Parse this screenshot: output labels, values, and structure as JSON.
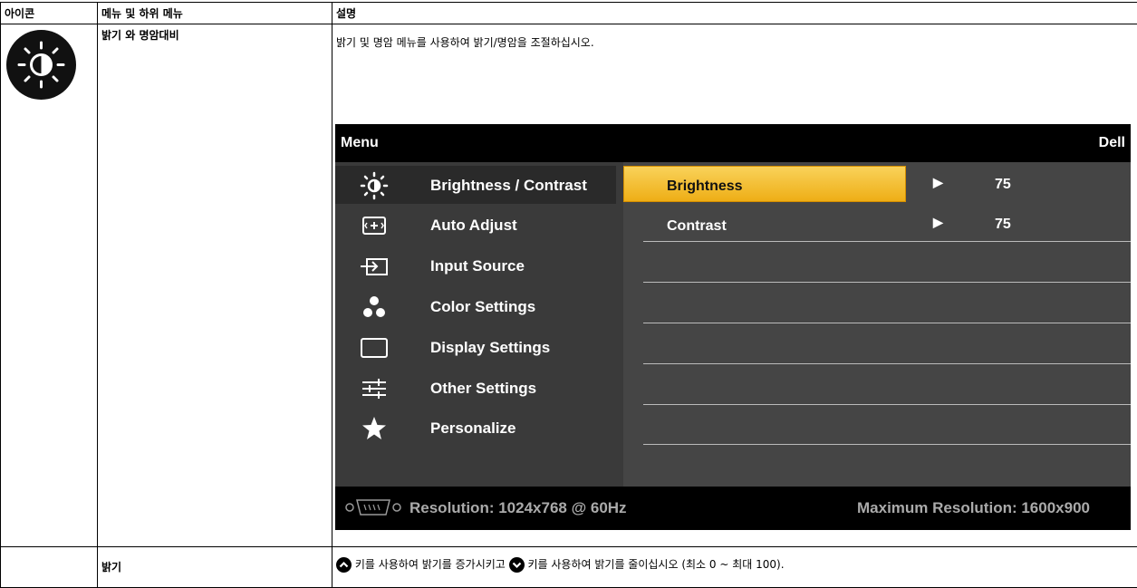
{
  "table": {
    "headers": {
      "icon": "아이콘",
      "menu": "메뉴 및 하위 메뉴",
      "desc": "설명"
    },
    "row1": {
      "menu": "밝기 와 명암대비",
      "desc": "밝기 및 명암 메뉴를 사용하여 밝기/명암을 조절하십시오."
    },
    "row2": {
      "menu": "밝기",
      "desc_part1": "키를 사용하여 밝기를 증가시키고",
      "desc_part2": "키를 사용하여 밝기를 줄이십시오 (최소 0 ~ 최대 100)."
    }
  },
  "osd": {
    "title": "Menu",
    "brand": "Dell",
    "menu_items": [
      {
        "label": "Brightness / Contrast",
        "icon": "brightness-icon"
      },
      {
        "label": "Auto Adjust",
        "icon": "auto-adjust-icon"
      },
      {
        "label": "Input Source",
        "icon": "input-source-icon"
      },
      {
        "label": "Color Settings",
        "icon": "color-settings-icon"
      },
      {
        "label": "Display Settings",
        "icon": "display-settings-icon"
      },
      {
        "label": "Other Settings",
        "icon": "other-settings-icon"
      },
      {
        "label": "Personalize",
        "icon": "star-icon"
      }
    ],
    "settings": [
      {
        "name": "Brightness",
        "value": "75"
      },
      {
        "name": "Contrast",
        "value": "75"
      }
    ],
    "footer": {
      "resolution": "Resolution: 1024x768 @ 60Hz",
      "max_resolution": "Maximum Resolution: 1600x900"
    },
    "highlight_color": "#f0b425"
  }
}
